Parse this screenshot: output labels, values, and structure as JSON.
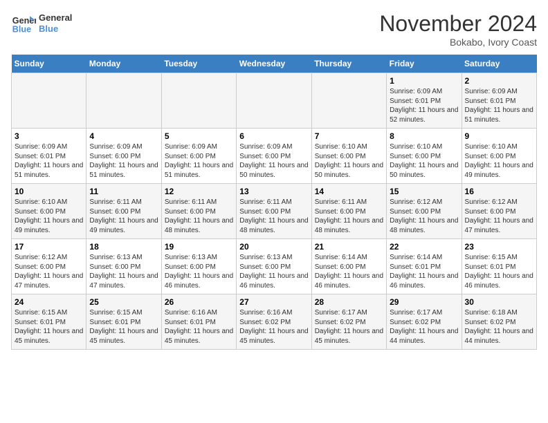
{
  "header": {
    "logo_line1": "General",
    "logo_line2": "Blue",
    "month": "November 2024",
    "location": "Bokabo, Ivory Coast"
  },
  "weekdays": [
    "Sunday",
    "Monday",
    "Tuesday",
    "Wednesday",
    "Thursday",
    "Friday",
    "Saturday"
  ],
  "weeks": [
    [
      {
        "day": "",
        "info": ""
      },
      {
        "day": "",
        "info": ""
      },
      {
        "day": "",
        "info": ""
      },
      {
        "day": "",
        "info": ""
      },
      {
        "day": "",
        "info": ""
      },
      {
        "day": "1",
        "info": "Sunrise: 6:09 AM\nSunset: 6:01 PM\nDaylight: 11 hours and 52 minutes."
      },
      {
        "day": "2",
        "info": "Sunrise: 6:09 AM\nSunset: 6:01 PM\nDaylight: 11 hours and 51 minutes."
      }
    ],
    [
      {
        "day": "3",
        "info": "Sunrise: 6:09 AM\nSunset: 6:01 PM\nDaylight: 11 hours and 51 minutes."
      },
      {
        "day": "4",
        "info": "Sunrise: 6:09 AM\nSunset: 6:00 PM\nDaylight: 11 hours and 51 minutes."
      },
      {
        "day": "5",
        "info": "Sunrise: 6:09 AM\nSunset: 6:00 PM\nDaylight: 11 hours and 51 minutes."
      },
      {
        "day": "6",
        "info": "Sunrise: 6:09 AM\nSunset: 6:00 PM\nDaylight: 11 hours and 50 minutes."
      },
      {
        "day": "7",
        "info": "Sunrise: 6:10 AM\nSunset: 6:00 PM\nDaylight: 11 hours and 50 minutes."
      },
      {
        "day": "8",
        "info": "Sunrise: 6:10 AM\nSunset: 6:00 PM\nDaylight: 11 hours and 50 minutes."
      },
      {
        "day": "9",
        "info": "Sunrise: 6:10 AM\nSunset: 6:00 PM\nDaylight: 11 hours and 49 minutes."
      }
    ],
    [
      {
        "day": "10",
        "info": "Sunrise: 6:10 AM\nSunset: 6:00 PM\nDaylight: 11 hours and 49 minutes."
      },
      {
        "day": "11",
        "info": "Sunrise: 6:11 AM\nSunset: 6:00 PM\nDaylight: 11 hours and 49 minutes."
      },
      {
        "day": "12",
        "info": "Sunrise: 6:11 AM\nSunset: 6:00 PM\nDaylight: 11 hours and 48 minutes."
      },
      {
        "day": "13",
        "info": "Sunrise: 6:11 AM\nSunset: 6:00 PM\nDaylight: 11 hours and 48 minutes."
      },
      {
        "day": "14",
        "info": "Sunrise: 6:11 AM\nSunset: 6:00 PM\nDaylight: 11 hours and 48 minutes."
      },
      {
        "day": "15",
        "info": "Sunrise: 6:12 AM\nSunset: 6:00 PM\nDaylight: 11 hours and 48 minutes."
      },
      {
        "day": "16",
        "info": "Sunrise: 6:12 AM\nSunset: 6:00 PM\nDaylight: 11 hours and 47 minutes."
      }
    ],
    [
      {
        "day": "17",
        "info": "Sunrise: 6:12 AM\nSunset: 6:00 PM\nDaylight: 11 hours and 47 minutes."
      },
      {
        "day": "18",
        "info": "Sunrise: 6:13 AM\nSunset: 6:00 PM\nDaylight: 11 hours and 47 minutes."
      },
      {
        "day": "19",
        "info": "Sunrise: 6:13 AM\nSunset: 6:00 PM\nDaylight: 11 hours and 46 minutes."
      },
      {
        "day": "20",
        "info": "Sunrise: 6:13 AM\nSunset: 6:00 PM\nDaylight: 11 hours and 46 minutes."
      },
      {
        "day": "21",
        "info": "Sunrise: 6:14 AM\nSunset: 6:00 PM\nDaylight: 11 hours and 46 minutes."
      },
      {
        "day": "22",
        "info": "Sunrise: 6:14 AM\nSunset: 6:01 PM\nDaylight: 11 hours and 46 minutes."
      },
      {
        "day": "23",
        "info": "Sunrise: 6:15 AM\nSunset: 6:01 PM\nDaylight: 11 hours and 46 minutes."
      }
    ],
    [
      {
        "day": "24",
        "info": "Sunrise: 6:15 AM\nSunset: 6:01 PM\nDaylight: 11 hours and 45 minutes."
      },
      {
        "day": "25",
        "info": "Sunrise: 6:15 AM\nSunset: 6:01 PM\nDaylight: 11 hours and 45 minutes."
      },
      {
        "day": "26",
        "info": "Sunrise: 6:16 AM\nSunset: 6:01 PM\nDaylight: 11 hours and 45 minutes."
      },
      {
        "day": "27",
        "info": "Sunrise: 6:16 AM\nSunset: 6:02 PM\nDaylight: 11 hours and 45 minutes."
      },
      {
        "day": "28",
        "info": "Sunrise: 6:17 AM\nSunset: 6:02 PM\nDaylight: 11 hours and 45 minutes."
      },
      {
        "day": "29",
        "info": "Sunrise: 6:17 AM\nSunset: 6:02 PM\nDaylight: 11 hours and 44 minutes."
      },
      {
        "day": "30",
        "info": "Sunrise: 6:18 AM\nSunset: 6:02 PM\nDaylight: 11 hours and 44 minutes."
      }
    ]
  ]
}
